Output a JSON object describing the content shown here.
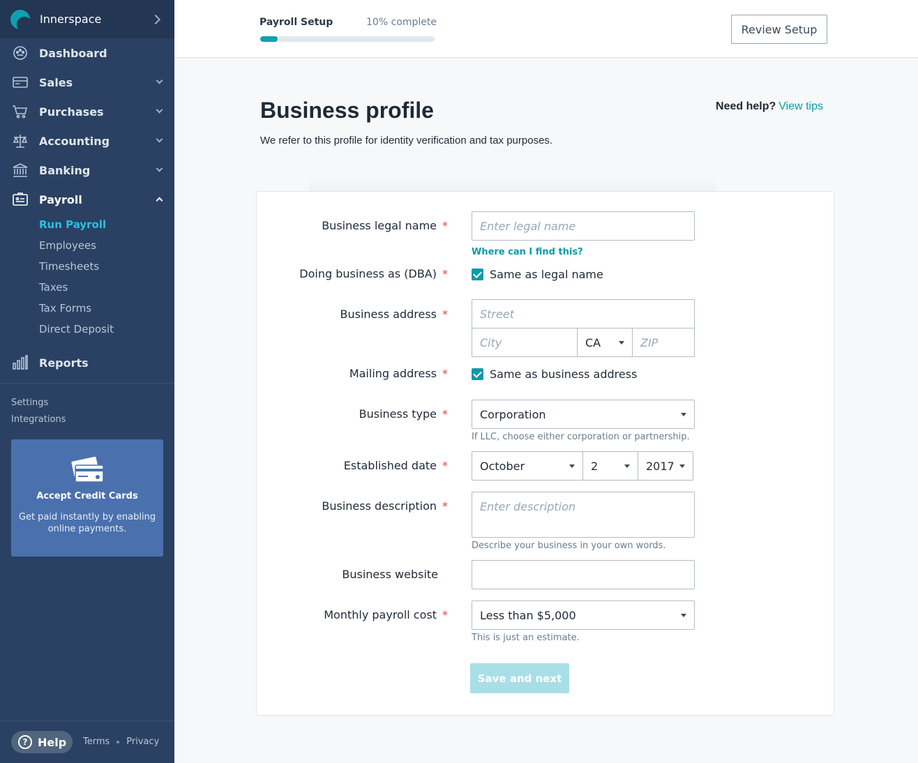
{
  "app": {
    "name": "Innerspace"
  },
  "sidebar": {
    "nav": [
      {
        "label": "Dashboard",
        "icon": "dashboard-icon"
      },
      {
        "label": "Sales",
        "icon": "sales-icon"
      },
      {
        "label": "Purchases",
        "icon": "cart-icon"
      },
      {
        "label": "Accounting",
        "icon": "scale-icon"
      },
      {
        "label": "Banking",
        "icon": "bank-icon"
      },
      {
        "label": "Payroll",
        "icon": "payroll-icon",
        "expanded": true
      },
      {
        "label": "Reports",
        "icon": "bar-chart-icon"
      }
    ],
    "payroll_sub": [
      "Run Payroll",
      "Employees",
      "Timesheets",
      "Taxes",
      "Tax Forms",
      "Direct Deposit"
    ],
    "active_sub": "Run Payroll",
    "aux": [
      "Settings",
      "Integrations"
    ],
    "promo": {
      "title": "Accept Credit Cards",
      "text": "Get paid instantly by enabling online payments."
    },
    "help": "Help",
    "footer": [
      "Terms",
      "Privacy"
    ]
  },
  "topbar": {
    "progress_label": "Payroll Setup",
    "progress_text": "10% complete",
    "progress_value": 0.1,
    "review_button": "Review Setup"
  },
  "page": {
    "title": "Business profile",
    "subtitle": "We refer to this profile for identity verification and tax purposes.",
    "help_prefix": "Need help?",
    "help_link": "View tips"
  },
  "form": {
    "legal_name": {
      "label": "Business legal name",
      "placeholder": "Enter legal name",
      "link": "Where can I find this?"
    },
    "dba": {
      "label": "Doing business as (DBA)",
      "checkbox": "Same as legal name",
      "checked": true
    },
    "address": {
      "label": "Business address",
      "street": "Street",
      "city": "City",
      "state": "CA",
      "zip": "ZIP"
    },
    "mailing": {
      "label": "Mailing address",
      "checkbox": "Same as business address",
      "checked": true
    },
    "type": {
      "label": "Business type",
      "value": "Corporation",
      "hint": "If LLC, choose either corporation or partnership."
    },
    "established": {
      "label": "Established date",
      "month": "October",
      "day": "2",
      "year": "2017"
    },
    "description": {
      "label": "Business description",
      "placeholder": "Enter description",
      "hint": "Describe your business in your own words."
    },
    "website": {
      "label": "Business website",
      "value": ""
    },
    "payroll_cost": {
      "label": "Monthly payroll cost",
      "value": "Less than $5,000",
      "hint": "This is just an estimate."
    },
    "required_mark": "*",
    "save_button": "Save and next"
  },
  "colors": {
    "accent": "#0e9aa8",
    "sidebar": "#2b4163",
    "active_sub": "#25c2e0",
    "required": "#e0443a"
  }
}
